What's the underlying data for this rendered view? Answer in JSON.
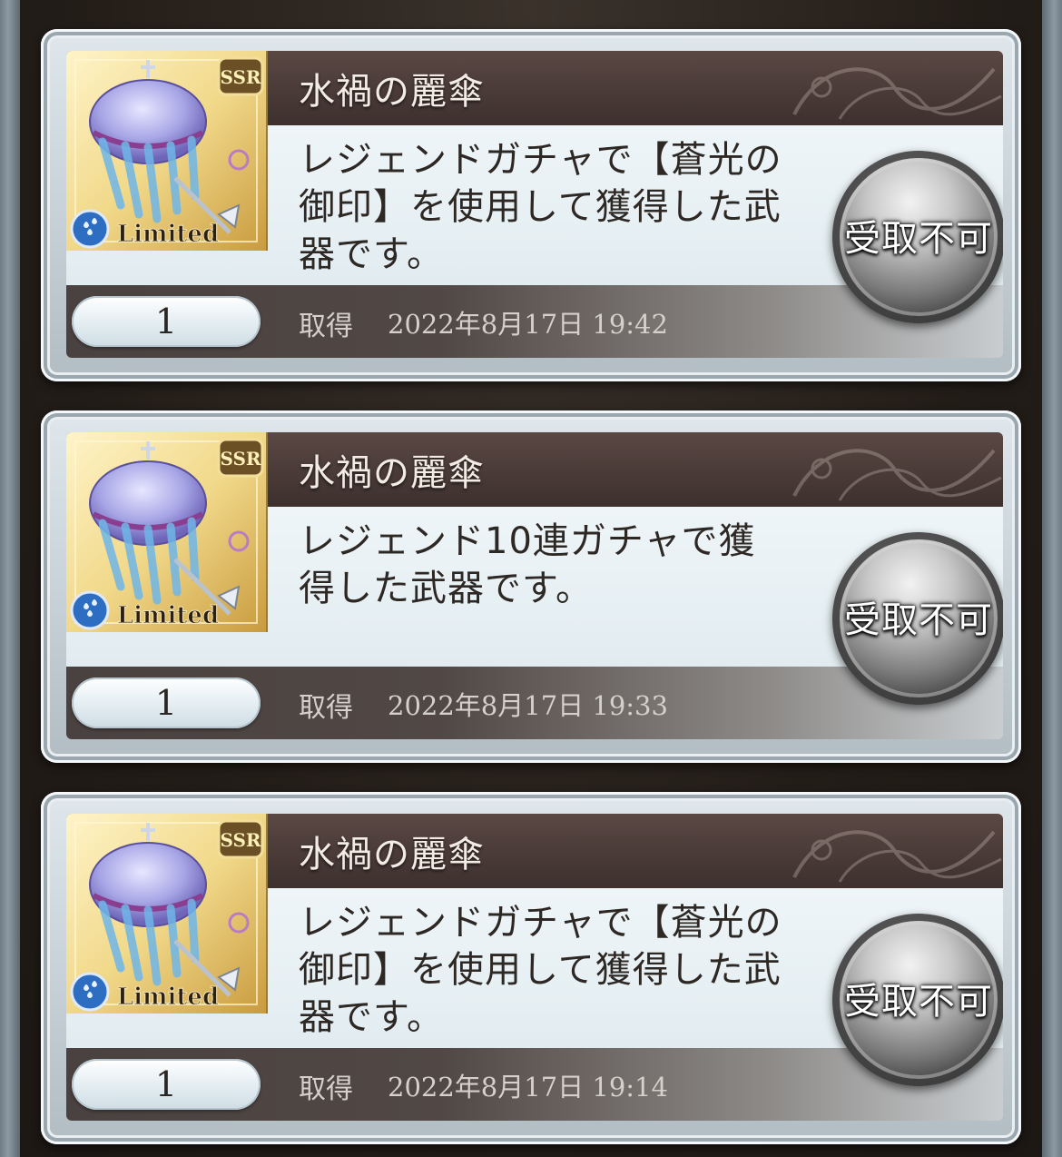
{
  "button_label": "受取不可",
  "items": [
    {
      "name": "水禍の麗傘",
      "description": "レジェンドガチャで【蒼光の御印】を使用して獲得した武器です。",
      "quantity": "1",
      "acquired_label": "取得",
      "acquired_at": "2022年8月17日 19:42",
      "rarity_badge": "SSR",
      "limited_badge": "Limited",
      "thumbnail_icon": "jellyfish-umbrella-weapon-icon",
      "element_icon": "water-element-icon"
    },
    {
      "name": "水禍の麗傘",
      "description": "レジェンド10連ガチャで獲得した武器です。",
      "quantity": "1",
      "acquired_label": "取得",
      "acquired_at": "2022年8月17日 19:33",
      "rarity_badge": "SSR",
      "limited_badge": "Limited",
      "thumbnail_icon": "jellyfish-umbrella-weapon-icon",
      "element_icon": "water-element-icon"
    },
    {
      "name": "水禍の麗傘",
      "description": "レジェンドガチャで【蒼光の御印】を使用して獲得した武器です。",
      "quantity": "1",
      "acquired_label": "取得",
      "acquired_at": "2022年8月17日 19:14",
      "rarity_badge": "SSR",
      "limited_badge": "Limited",
      "thumbnail_icon": "jellyfish-umbrella-weapon-icon",
      "element_icon": "water-element-icon"
    }
  ]
}
